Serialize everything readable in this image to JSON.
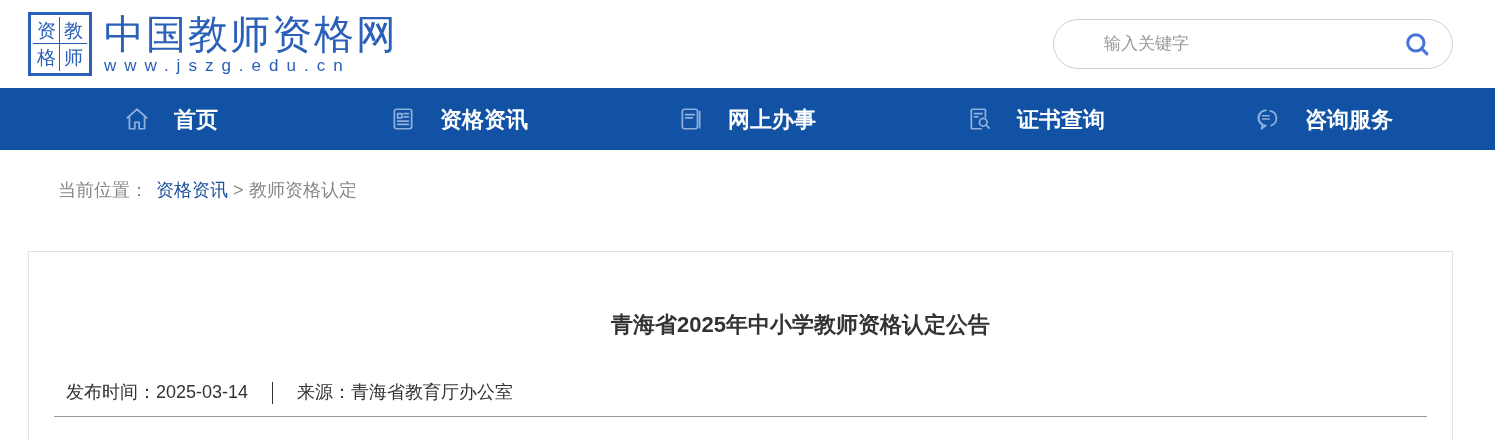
{
  "logo": {
    "seal": [
      "资",
      "教",
      "格",
      "师"
    ],
    "name": "中国教师资格网",
    "url": "www.jszg.edu.cn"
  },
  "search": {
    "placeholder": "输入关键字"
  },
  "nav": [
    {
      "label": "首页",
      "kind": "home"
    },
    {
      "label": "资格资讯",
      "kind": "news"
    },
    {
      "label": "网上办事",
      "kind": "doc"
    },
    {
      "label": "证书查询",
      "kind": "query"
    },
    {
      "label": "咨询服务",
      "kind": "chat"
    }
  ],
  "breadcrumb": {
    "prefix": "当前位置：",
    "items": [
      {
        "label": "资格资讯",
        "kind": "link"
      },
      {
        "label": " > 教师资格认定",
        "kind": "text"
      }
    ]
  },
  "article": {
    "title": "青海省2025年中小学教师资格认定公告",
    "published": "发布时间：2025-03-14",
    "source": "来源：青海省教育厅办公室"
  }
}
